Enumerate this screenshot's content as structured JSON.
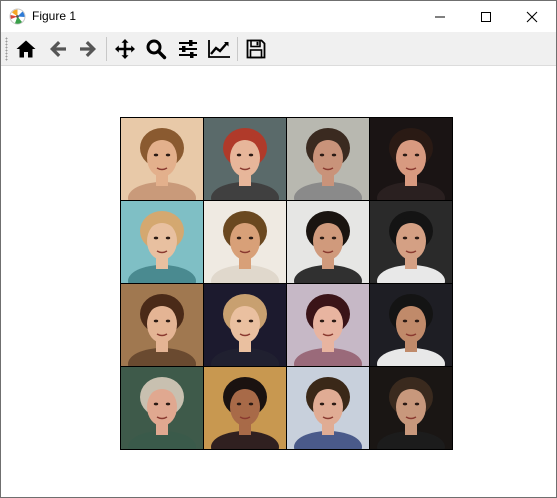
{
  "window": {
    "title": "Figure 1",
    "controls": [
      "minimize",
      "maximize",
      "close"
    ]
  },
  "toolbar": {
    "tools": [
      {
        "name": "home",
        "icon": "home-icon"
      },
      {
        "name": "back",
        "icon": "arrow-left-icon"
      },
      {
        "name": "forward",
        "icon": "arrow-right-icon"
      },
      {
        "name": "pan",
        "icon": "move-icon"
      },
      {
        "name": "zoom",
        "icon": "magnifier-icon"
      },
      {
        "name": "configure-subplots",
        "icon": "sliders-icon"
      },
      {
        "name": "edit-axes",
        "icon": "line-chart-icon"
      },
      {
        "name": "save",
        "icon": "floppy-disk-icon"
      }
    ]
  },
  "figure": {
    "grid_rows": 4,
    "grid_cols": 4,
    "cells": [
      {
        "bg": "#e8c9a8",
        "hair": "#8a5a30",
        "skin": "#e3b08c",
        "clothes": "#c99a7a"
      },
      {
        "bg": "#5a6a6a",
        "hair": "#b03a2a",
        "skin": "#e7b69a",
        "clothes": "#404040"
      },
      {
        "bg": "#b8b8b0",
        "hair": "#3a2a20",
        "skin": "#c9937a",
        "clothes": "#8a8a8a"
      },
      {
        "bg": "#1a1414",
        "hair": "#2a1a14",
        "skin": "#d89a80",
        "clothes": "#2a2020"
      },
      {
        "bg": "#7fbfc5",
        "hair": "#d4a870",
        "skin": "#e8c0a0",
        "clothes": "#4a8a90"
      },
      {
        "bg": "#efeae2",
        "hair": "#6a4820",
        "skin": "#d8a078",
        "clothes": "#e0d8cc"
      },
      {
        "bg": "#e6e6e4",
        "hair": "#1a1410",
        "skin": "#d09a7c",
        "clothes": "#303030"
      },
      {
        "bg": "#2a2a2a",
        "hair": "#141414",
        "skin": "#d4a084",
        "clothes": "#e8e8e8"
      },
      {
        "bg": "#a07850",
        "hair": "#4a2a18",
        "skin": "#e4b494",
        "clothes": "#6a4a30"
      },
      {
        "bg": "#1c1a2e",
        "hair": "#c8a070",
        "skin": "#eac0a0",
        "clothes": "#202030"
      },
      {
        "bg": "#c6b8c6",
        "hair": "#3a1418",
        "skin": "#e8b4a0",
        "clothes": "#9a6a7a"
      },
      {
        "bg": "#1e1e24",
        "hair": "#141414",
        "skin": "#c08a6a",
        "clothes": "#e8e8e8"
      },
      {
        "bg": "#3e5a4a",
        "hair": "#c8c0b0",
        "skin": "#e0a890",
        "clothes": "#3a5a4a"
      },
      {
        "bg": "#c89850",
        "hair": "#1a1210",
        "skin": "#a86a48",
        "clothes": "#302020"
      },
      {
        "bg": "#c8d0dc",
        "hair": "#3a2818",
        "skin": "#e0ac94",
        "clothes": "#4a5a8a"
      },
      {
        "bg": "#1a1614",
        "hair": "#3a2a1e",
        "skin": "#c8987c",
        "clothes": "#1c1c1c"
      }
    ]
  }
}
